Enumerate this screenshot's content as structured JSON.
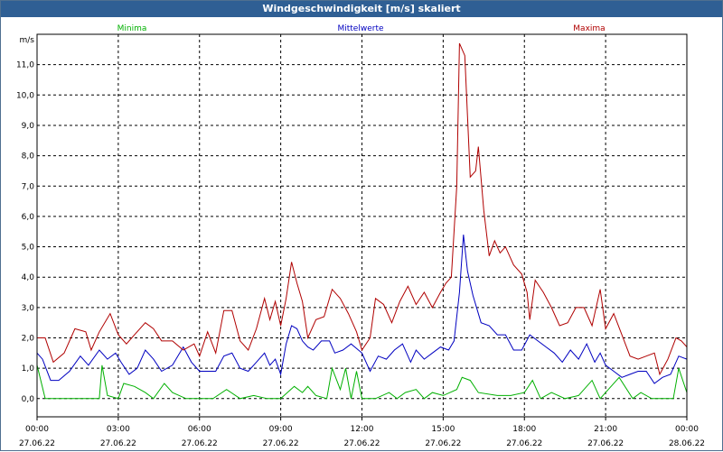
{
  "title": "Windgeschwindigkeit [m/s] skaliert",
  "colors": {
    "titlebar": "#2f5f94",
    "minima": "#00b000",
    "mittel": "#0000c0",
    "maxima": "#b00000",
    "grid": "#000000"
  },
  "chart_data": {
    "type": "line",
    "title": "Windgeschwindigkeit [m/s] skaliert",
    "ylabel": "m/s",
    "ylim": [
      -0.6,
      12.0
    ],
    "yticks": [
      "0,0",
      "1,0",
      "2,0",
      "3,0",
      "4,0",
      "5,0",
      "6,0",
      "7,0",
      "8,0",
      "9,0",
      "10,0",
      "11,0"
    ],
    "xlim_hours": [
      0,
      24
    ],
    "xticks": [
      {
        "time": "00:00",
        "date": "27.06.22"
      },
      {
        "time": "03:00",
        "date": "27.06.22"
      },
      {
        "time": "06:00",
        "date": "27.06.22"
      },
      {
        "time": "09:00",
        "date": "27.06.22"
      },
      {
        "time": "12:00",
        "date": "27.06.22"
      },
      {
        "time": "15:00",
        "date": "27.06.22"
      },
      {
        "time": "18:00",
        "date": "27.06.22"
      },
      {
        "time": "21:00",
        "date": "27.06.22"
      },
      {
        "time": "00:00",
        "date": "28.06.22"
      }
    ],
    "grid": true,
    "legend": "top",
    "series": [
      {
        "name": "Minima",
        "points": [
          [
            0,
            1.1
          ],
          [
            0.3,
            0.0
          ],
          [
            1,
            0.0
          ],
          [
            1.5,
            0.0
          ],
          [
            2.3,
            0.0
          ],
          [
            2.4,
            1.1
          ],
          [
            2.6,
            0.1
          ],
          [
            3,
            0.0
          ],
          [
            3.2,
            0.5
          ],
          [
            3.6,
            0.4
          ],
          [
            4,
            0.2
          ],
          [
            4.3,
            0.0
          ],
          [
            4.7,
            0.5
          ],
          [
            5,
            0.2
          ],
          [
            5.5,
            0.0
          ],
          [
            6,
            0.0
          ],
          [
            6.5,
            0.0
          ],
          [
            7,
            0.3
          ],
          [
            7.5,
            0.0
          ],
          [
            8,
            0.1
          ],
          [
            8.5,
            0.0
          ],
          [
            9,
            0.0
          ],
          [
            9.5,
            0.4
          ],
          [
            9.8,
            0.2
          ],
          [
            10,
            0.4
          ],
          [
            10.3,
            0.1
          ],
          [
            10.7,
            0.0
          ],
          [
            10.9,
            1.0
          ],
          [
            11.2,
            0.3
          ],
          [
            11.4,
            1.0
          ],
          [
            11.6,
            0.0
          ],
          [
            11.8,
            0.9
          ],
          [
            12,
            0.0
          ],
          [
            12.5,
            0.0
          ],
          [
            13,
            0.2
          ],
          [
            13.3,
            0.0
          ],
          [
            13.6,
            0.2
          ],
          [
            14,
            0.3
          ],
          [
            14.3,
            0.0
          ],
          [
            14.6,
            0.2
          ],
          [
            15,
            0.1
          ],
          [
            15.5,
            0.3
          ],
          [
            15.7,
            0.7
          ],
          [
            16,
            0.6
          ],
          [
            16.3,
            0.2
          ],
          [
            17,
            0.1
          ],
          [
            17.5,
            0.1
          ],
          [
            18,
            0.2
          ],
          [
            18.3,
            0.6
          ],
          [
            18.6,
            0.0
          ],
          [
            19,
            0.2
          ],
          [
            19.5,
            0.0
          ],
          [
            20,
            0.1
          ],
          [
            20.5,
            0.6
          ],
          [
            20.8,
            0.0
          ],
          [
            21,
            0.2
          ],
          [
            21.5,
            0.7
          ],
          [
            22,
            0.0
          ],
          [
            22.3,
            0.2
          ],
          [
            22.7,
            0.0
          ],
          [
            23,
            0.0
          ],
          [
            23.5,
            0.0
          ],
          [
            23.7,
            1.0
          ],
          [
            24,
            0.2
          ]
        ]
      },
      {
        "name": "Mittelwerte",
        "points": [
          [
            0,
            1.5
          ],
          [
            0.2,
            1.3
          ],
          [
            0.5,
            0.6
          ],
          [
            0.8,
            0.6
          ],
          [
            1.2,
            0.9
          ],
          [
            1.6,
            1.4
          ],
          [
            1.9,
            1.1
          ],
          [
            2.3,
            1.6
          ],
          [
            2.6,
            1.3
          ],
          [
            2.9,
            1.5
          ],
          [
            3.1,
            1.2
          ],
          [
            3.4,
            0.8
          ],
          [
            3.7,
            1.0
          ],
          [
            4.0,
            1.6
          ],
          [
            4.3,
            1.3
          ],
          [
            4.6,
            0.9
          ],
          [
            5.0,
            1.1
          ],
          [
            5.4,
            1.7
          ],
          [
            5.7,
            1.2
          ],
          [
            6.0,
            0.9
          ],
          [
            6.3,
            0.9
          ],
          [
            6.6,
            0.9
          ],
          [
            6.9,
            1.4
          ],
          [
            7.2,
            1.5
          ],
          [
            7.5,
            1.0
          ],
          [
            7.8,
            0.9
          ],
          [
            8.1,
            1.2
          ],
          [
            8.4,
            1.5
          ],
          [
            8.6,
            1.1
          ],
          [
            8.8,
            1.3
          ],
          [
            9.0,
            0.8
          ],
          [
            9.2,
            1.8
          ],
          [
            9.4,
            2.4
          ],
          [
            9.6,
            2.3
          ],
          [
            9.8,
            1.9
          ],
          [
            10.0,
            1.7
          ],
          [
            10.2,
            1.6
          ],
          [
            10.5,
            1.9
          ],
          [
            10.8,
            1.9
          ],
          [
            11.0,
            1.5
          ],
          [
            11.3,
            1.6
          ],
          [
            11.6,
            1.8
          ],
          [
            12.0,
            1.5
          ],
          [
            12.3,
            0.9
          ],
          [
            12.6,
            1.4
          ],
          [
            12.9,
            1.3
          ],
          [
            13.2,
            1.6
          ],
          [
            13.5,
            1.8
          ],
          [
            13.8,
            1.2
          ],
          [
            14.0,
            1.6
          ],
          [
            14.3,
            1.3
          ],
          [
            14.6,
            1.5
          ],
          [
            14.9,
            1.7
          ],
          [
            15.2,
            1.6
          ],
          [
            15.4,
            1.9
          ],
          [
            15.6,
            3.5
          ],
          [
            15.75,
            5.4
          ],
          [
            15.9,
            4.2
          ],
          [
            16.1,
            3.4
          ],
          [
            16.4,
            2.5
          ],
          [
            16.7,
            2.4
          ],
          [
            17.0,
            2.1
          ],
          [
            17.3,
            2.1
          ],
          [
            17.6,
            1.6
          ],
          [
            17.9,
            1.6
          ],
          [
            18.2,
            2.1
          ],
          [
            18.5,
            1.9
          ],
          [
            18.8,
            1.7
          ],
          [
            19.1,
            1.5
          ],
          [
            19.4,
            1.2
          ],
          [
            19.7,
            1.6
          ],
          [
            20.0,
            1.3
          ],
          [
            20.3,
            1.8
          ],
          [
            20.6,
            1.2
          ],
          [
            20.8,
            1.5
          ],
          [
            21.0,
            1.1
          ],
          [
            21.3,
            0.9
          ],
          [
            21.6,
            0.7
          ],
          [
            21.9,
            0.8
          ],
          [
            22.2,
            0.9
          ],
          [
            22.5,
            0.9
          ],
          [
            22.8,
            0.5
          ],
          [
            23.1,
            0.7
          ],
          [
            23.4,
            0.8
          ],
          [
            23.7,
            1.4
          ],
          [
            24.0,
            1.3
          ]
        ]
      },
      {
        "name": "Maxima",
        "points": [
          [
            0,
            2.0
          ],
          [
            0.3,
            2.0
          ],
          [
            0.6,
            1.2
          ],
          [
            1.0,
            1.5
          ],
          [
            1.4,
            2.3
          ],
          [
            1.8,
            2.2
          ],
          [
            2.0,
            1.6
          ],
          [
            2.3,
            2.2
          ],
          [
            2.7,
            2.8
          ],
          [
            3.0,
            2.1
          ],
          [
            3.3,
            1.8
          ],
          [
            3.6,
            2.1
          ],
          [
            4.0,
            2.5
          ],
          [
            4.3,
            2.3
          ],
          [
            4.6,
            1.9
          ],
          [
            5.0,
            1.9
          ],
          [
            5.4,
            1.6
          ],
          [
            5.8,
            1.8
          ],
          [
            6.0,
            1.4
          ],
          [
            6.3,
            2.2
          ],
          [
            6.6,
            1.5
          ],
          [
            6.9,
            2.9
          ],
          [
            7.2,
            2.9
          ],
          [
            7.5,
            1.9
          ],
          [
            7.8,
            1.6
          ],
          [
            8.1,
            2.3
          ],
          [
            8.4,
            3.3
          ],
          [
            8.6,
            2.6
          ],
          [
            8.8,
            3.2
          ],
          [
            9.0,
            2.4
          ],
          [
            9.2,
            3.3
          ],
          [
            9.4,
            4.5
          ],
          [
            9.6,
            3.8
          ],
          [
            9.8,
            3.2
          ],
          [
            10.0,
            2.0
          ],
          [
            10.3,
            2.6
          ],
          [
            10.6,
            2.7
          ],
          [
            10.9,
            3.6
          ],
          [
            11.2,
            3.3
          ],
          [
            11.5,
            2.8
          ],
          [
            11.8,
            2.2
          ],
          [
            12.0,
            1.6
          ],
          [
            12.3,
            2.0
          ],
          [
            12.5,
            3.3
          ],
          [
            12.8,
            3.1
          ],
          [
            13.1,
            2.5
          ],
          [
            13.4,
            3.2
          ],
          [
            13.7,
            3.7
          ],
          [
            14.0,
            3.1
          ],
          [
            14.3,
            3.5
          ],
          [
            14.6,
            3.0
          ],
          [
            14.9,
            3.5
          ],
          [
            15.1,
            3.8
          ],
          [
            15.3,
            4.0
          ],
          [
            15.5,
            7.0
          ],
          [
            15.6,
            11.7
          ],
          [
            15.8,
            11.3
          ],
          [
            16.0,
            7.3
          ],
          [
            16.2,
            7.5
          ],
          [
            16.3,
            8.3
          ],
          [
            16.5,
            6.2
          ],
          [
            16.7,
            4.7
          ],
          [
            16.9,
            5.2
          ],
          [
            17.1,
            4.8
          ],
          [
            17.3,
            5.0
          ],
          [
            17.6,
            4.4
          ],
          [
            17.9,
            4.1
          ],
          [
            18.1,
            3.5
          ],
          [
            18.2,
            2.6
          ],
          [
            18.4,
            3.9
          ],
          [
            18.7,
            3.5
          ],
          [
            19.0,
            3.0
          ],
          [
            19.3,
            2.4
          ],
          [
            19.6,
            2.5
          ],
          [
            19.9,
            3.0
          ],
          [
            20.2,
            3.0
          ],
          [
            20.5,
            2.4
          ],
          [
            20.8,
            3.6
          ],
          [
            21.0,
            2.3
          ],
          [
            21.3,
            2.8
          ],
          [
            21.6,
            2.1
          ],
          [
            21.9,
            1.4
          ],
          [
            22.2,
            1.3
          ],
          [
            22.5,
            1.4
          ],
          [
            22.8,
            1.5
          ],
          [
            23.0,
            0.8
          ],
          [
            23.3,
            1.3
          ],
          [
            23.6,
            2.0
          ],
          [
            23.8,
            1.9
          ],
          [
            24.0,
            1.7
          ]
        ]
      }
    ]
  }
}
